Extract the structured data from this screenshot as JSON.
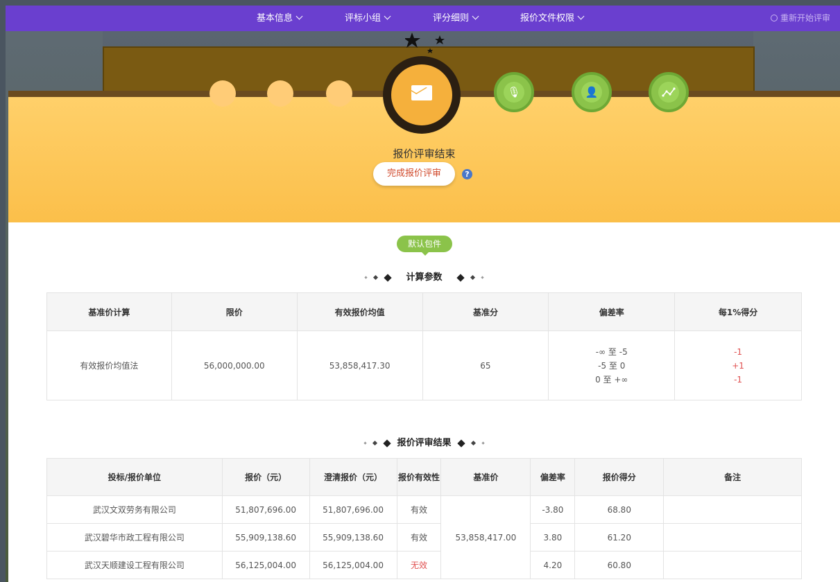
{
  "nav": {
    "items": [
      "基本信息",
      "评标小组",
      "评分细则",
      "报价文件权限"
    ],
    "restart_label": "重新开始评审"
  },
  "icons": {
    "main": "envelope-icon",
    "steps": [
      "microphone-icon",
      "user-icon",
      "trend-line-icon"
    ]
  },
  "status": {
    "title": "报价评审结束",
    "complete_button": "完成报价评审",
    "help": "?"
  },
  "package_tag": "默认包件",
  "params": {
    "title": "计算参数",
    "headers": [
      "基准价计算",
      "限价",
      "有效报价均值",
      "基准分",
      "偏差率",
      "每1%得分"
    ],
    "row": {
      "method": "有效报价均值法",
      "limit": "56,000,000.00",
      "avg": "53,858,417.30",
      "base_score": "65",
      "deviation_ranges": [
        "-∞ 至 -5",
        "-5 至 0",
        "0 至 +∞"
      ],
      "scores_per_pct": [
        "-1",
        "+1",
        "-1"
      ]
    }
  },
  "results": {
    "title": "报价评审结果",
    "headers": [
      "投标/报价单位",
      "报价（元）",
      "澄清报价（元）",
      "报价有效性",
      "基准价",
      "偏差率",
      "报价得分",
      "备注"
    ],
    "base_price": "53,858,417.00",
    "rows": [
      {
        "unit": "武汉文双劳务有限公司",
        "price": "51,807,696.00",
        "clarified": "51,807,696.00",
        "validity": "有效",
        "deviation": "-3.80",
        "score": "68.80",
        "note": ""
      },
      {
        "unit": "武汉碧华市政工程有限公司",
        "price": "55,909,138.60",
        "clarified": "55,909,138.60",
        "validity": "有效",
        "deviation": "3.80",
        "score": "61.20",
        "note": ""
      },
      {
        "unit": "武汉天顺建设工程有限公司",
        "price": "56,125,004.00",
        "clarified": "56,125,004.00",
        "validity": "无效",
        "deviation": "4.20",
        "score": "60.80",
        "note": ""
      }
    ]
  },
  "colors": {
    "nav_bg": "#6a3fcf",
    "header_bg": "#fbbf4a",
    "accent_green": "#8bc34a",
    "invalid_red": "#e05050"
  }
}
